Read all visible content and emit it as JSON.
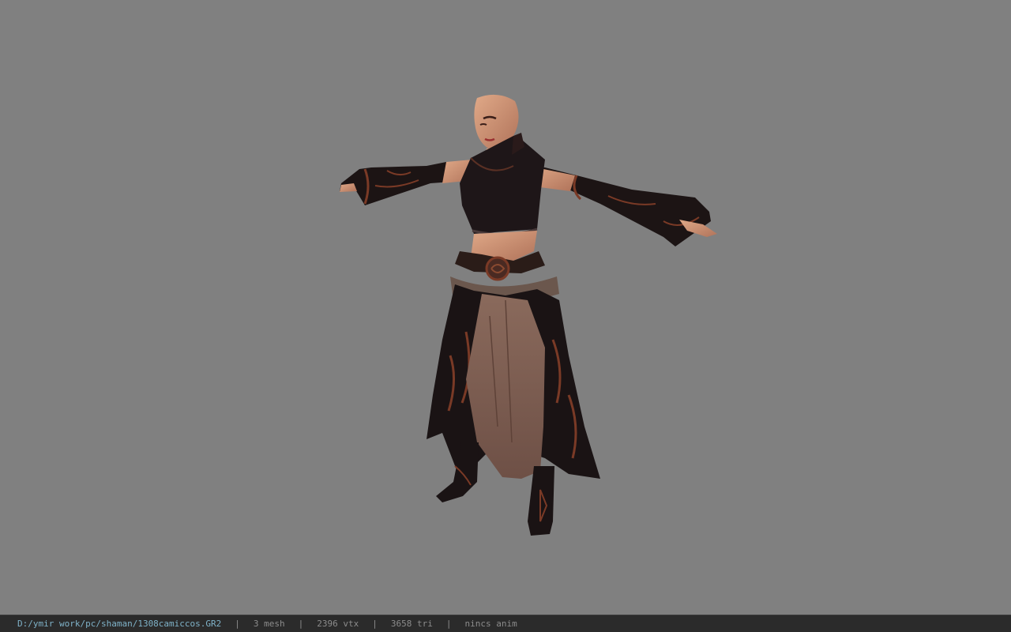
{
  "viewport": {
    "background": "#808080",
    "model": "character-model"
  },
  "status_bar": {
    "file_path": "D:/ymir work/pc/shaman/1308camiccos.GR2",
    "separator": "|",
    "mesh": "3 mesh",
    "vertices": "2396 vtx",
    "triangles": "3658 tri",
    "animation": "nincs anim"
  }
}
